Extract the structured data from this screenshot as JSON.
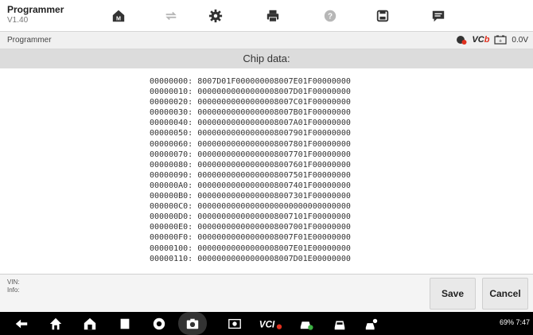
{
  "app": {
    "title": "Programmer",
    "version": "V1.40"
  },
  "toolbar": {
    "items": [
      {
        "name": "home-icon"
      },
      {
        "name": "vehicle-swap-icon"
      },
      {
        "name": "settings-gear-icon"
      },
      {
        "name": "print-icon"
      },
      {
        "name": "help-icon"
      },
      {
        "name": "save-icon"
      },
      {
        "name": "message-icon"
      }
    ]
  },
  "subheader": {
    "breadcrumb": "Programmer",
    "vci_label": "VC",
    "vci_suffix": "b",
    "battery": "0.0V"
  },
  "heading": "Chip data:",
  "dump": [
    "00000000: 8007D01F000000008007E01F00000000",
    "00000010: 00000000000000008007D01F00000000",
    "00000020: 00000000000000008007C01F00000000",
    "00000030: 00000000000000008007B01F00000000",
    "00000040: 00000000000000008007A01F00000000",
    "00000050: 00000000000000008007901F00000000",
    "00000060: 00000000000000008007801F00000000",
    "00000070: 00000000000000008007701F00000000",
    "00000080: 00000000000000008007601F00000000",
    "00000090: 00000000000000008007501F00000000",
    "000000A0: 00000000000000008007401F00000000",
    "000000B0: 00000000000000008007301F00000000",
    "000000C0: 00000000000000000000000000000000",
    "000000D0: 00000000000000008007101F00000000",
    "000000E0: 00000000000000008007001F00000000",
    "000000F0: 00000000000000008007F01E00000000",
    "00000100: 00000000000000008007E01E00000000",
    "00000110: 00000000000000008007D01E00000000"
  ],
  "footer": {
    "vin_label": "VIN:",
    "info_label": "Info:",
    "save_label": "Save",
    "cancel_label": "Cancel"
  },
  "system": {
    "status": "69% 7:47"
  }
}
